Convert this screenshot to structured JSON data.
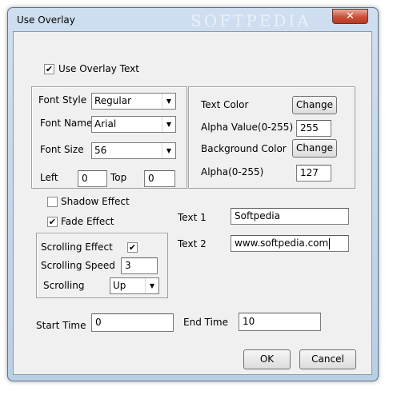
{
  "window": {
    "title": "Use Overlay",
    "watermark": "SOFTPEDIA",
    "close_glyph": "✕"
  },
  "use_overlay_text": {
    "label": "Use Overlay Text",
    "checked": true
  },
  "font": {
    "style_label": "Font Style",
    "style_value": "Regular",
    "name_label": "Font Name",
    "name_value": "Arial",
    "size_label": "Font Size",
    "size_value": "56",
    "left_label": "Left",
    "left_value": "0",
    "top_label": "Top",
    "top_value": "0"
  },
  "color": {
    "text_color_label": "Text Color",
    "text_color_button": "Change",
    "alpha_value_label": "Alpha Value(0-255)",
    "alpha_value": "255",
    "background_color_label": "Background Color",
    "background_color_button": "Change",
    "alpha_label": "Alpha(0-255)",
    "alpha": "127"
  },
  "effects": {
    "shadow_label": "Shadow Effect",
    "shadow_checked": false,
    "fade_label": "Fade Effect",
    "fade_checked": true
  },
  "text": {
    "text1_label": "Text 1",
    "text1_value": "Softpedia",
    "text2_label": "Text 2",
    "text2_value": "www.softpedia.com"
  },
  "scrolling": {
    "effect_label": "Scrolling Effect",
    "effect_checked": true,
    "speed_label": "Scrolling Speed",
    "speed_value": "3",
    "direction_label": "Scrolling",
    "direction_value": "Up"
  },
  "time": {
    "start_label": "Start Time",
    "start_value": "0",
    "end_label": "End Time",
    "end_value": "10"
  },
  "buttons": {
    "ok": "OK",
    "cancel": "Cancel"
  },
  "icons": {
    "check": "✔",
    "dropdown": "▼"
  }
}
